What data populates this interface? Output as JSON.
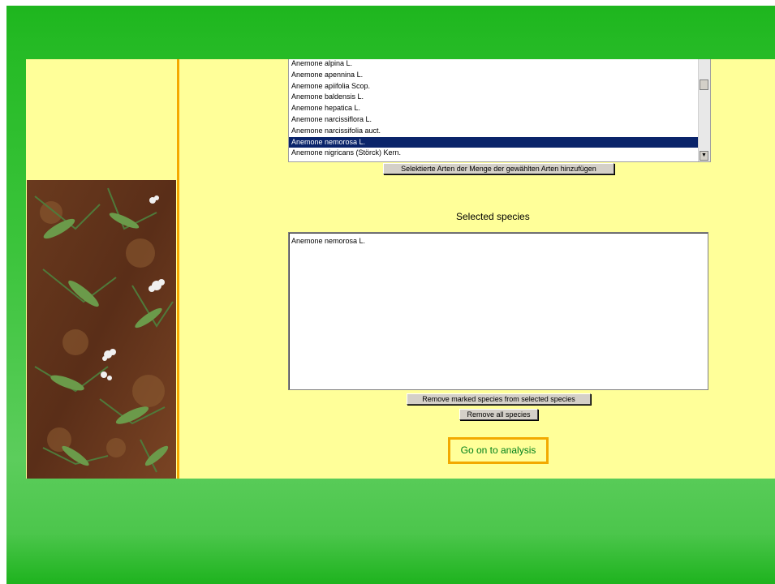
{
  "available_species": {
    "items": [
      "Anemone alpina L.",
      "Anemone apennina L.",
      "Anemone apiifolia Scop.",
      "Anemone baldensis L.",
      "Anemone hepatica L.",
      "Anemone narcissiflora L.",
      "Anemone narcissifolia auct.",
      "Anemone nemorosa L.",
      "Anemone nigricans (Störck) Kern."
    ],
    "selected_item": "Anemone nemorosa L.",
    "add_button": "Selektierte Arten der Menge der gewählten Arten hinzufügen"
  },
  "selected_species": {
    "title": "Selected species",
    "items": [
      "Anemone nemorosa L."
    ],
    "remove_marked_button": "Remove marked species from selected species",
    "remove_all_button": "Remove all species"
  },
  "analysis_link": "Go on to analysis",
  "colors": {
    "slide_green": "#1eb61e",
    "content_yellow": "#ffff99",
    "divider_orange": "#f5a800",
    "selection_navy": "#0a246a",
    "link_green": "#00801a"
  },
  "icons": {
    "scroll_down": "triangle-down-icon"
  }
}
